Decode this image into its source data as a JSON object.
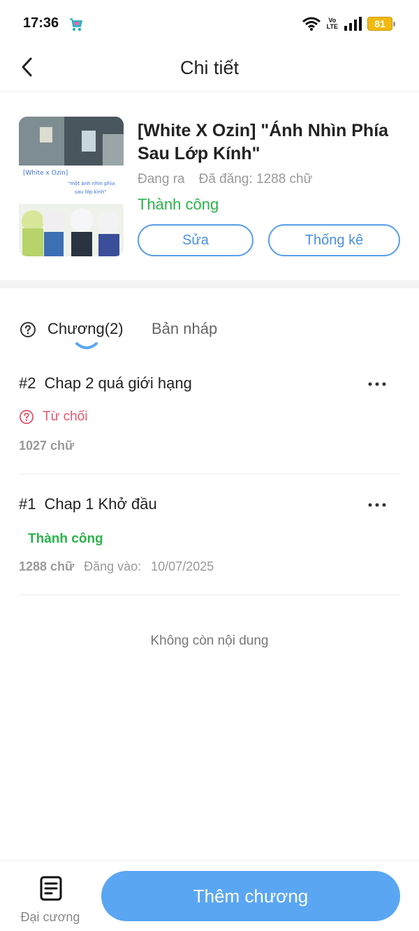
{
  "status_bar": {
    "time": "17:36",
    "network_label_top": "Vo",
    "network_label_bottom": "LTE",
    "battery": "81"
  },
  "header": {
    "title": "Chi tiết"
  },
  "book": {
    "title": "[White X Ozin] \"Ánh Nhìn Phía Sau Lớp Kính\"",
    "state": "Đang ra",
    "word_count": "Đã đăng: 1288 chữ",
    "status": "Thành công",
    "status_color": "#29b34a",
    "edit_label": "Sửa",
    "stats_label": "Thống kê",
    "cover": {
      "caption_title": "[White x Ozin]",
      "caption_line1": "\"một ánh nhìn phía",
      "caption_line2": "sau lớp kính\""
    }
  },
  "tabs": {
    "chapters_label": "Chương(2)",
    "drafts_label": "Bản nháp"
  },
  "chapters": [
    {
      "number": "#2",
      "title": "Chap 2 quá giới hạng",
      "status": "Từ chối",
      "status_color": "#e8566e",
      "words": "1027 chữ"
    },
    {
      "number": "#1",
      "title": "Chap 1 Khở đầu",
      "status": "Thành công",
      "status_color": "#29b34a",
      "words": "1288 chữ",
      "published_label": "Đăng vào:",
      "published_date": "10/07/2025"
    }
  ],
  "empty_note": "Không còn nội dung",
  "bottom_bar": {
    "outline_label": "Đại cương",
    "add_chapter_label": "Thêm chương",
    "accent": "#5aa6f3"
  }
}
